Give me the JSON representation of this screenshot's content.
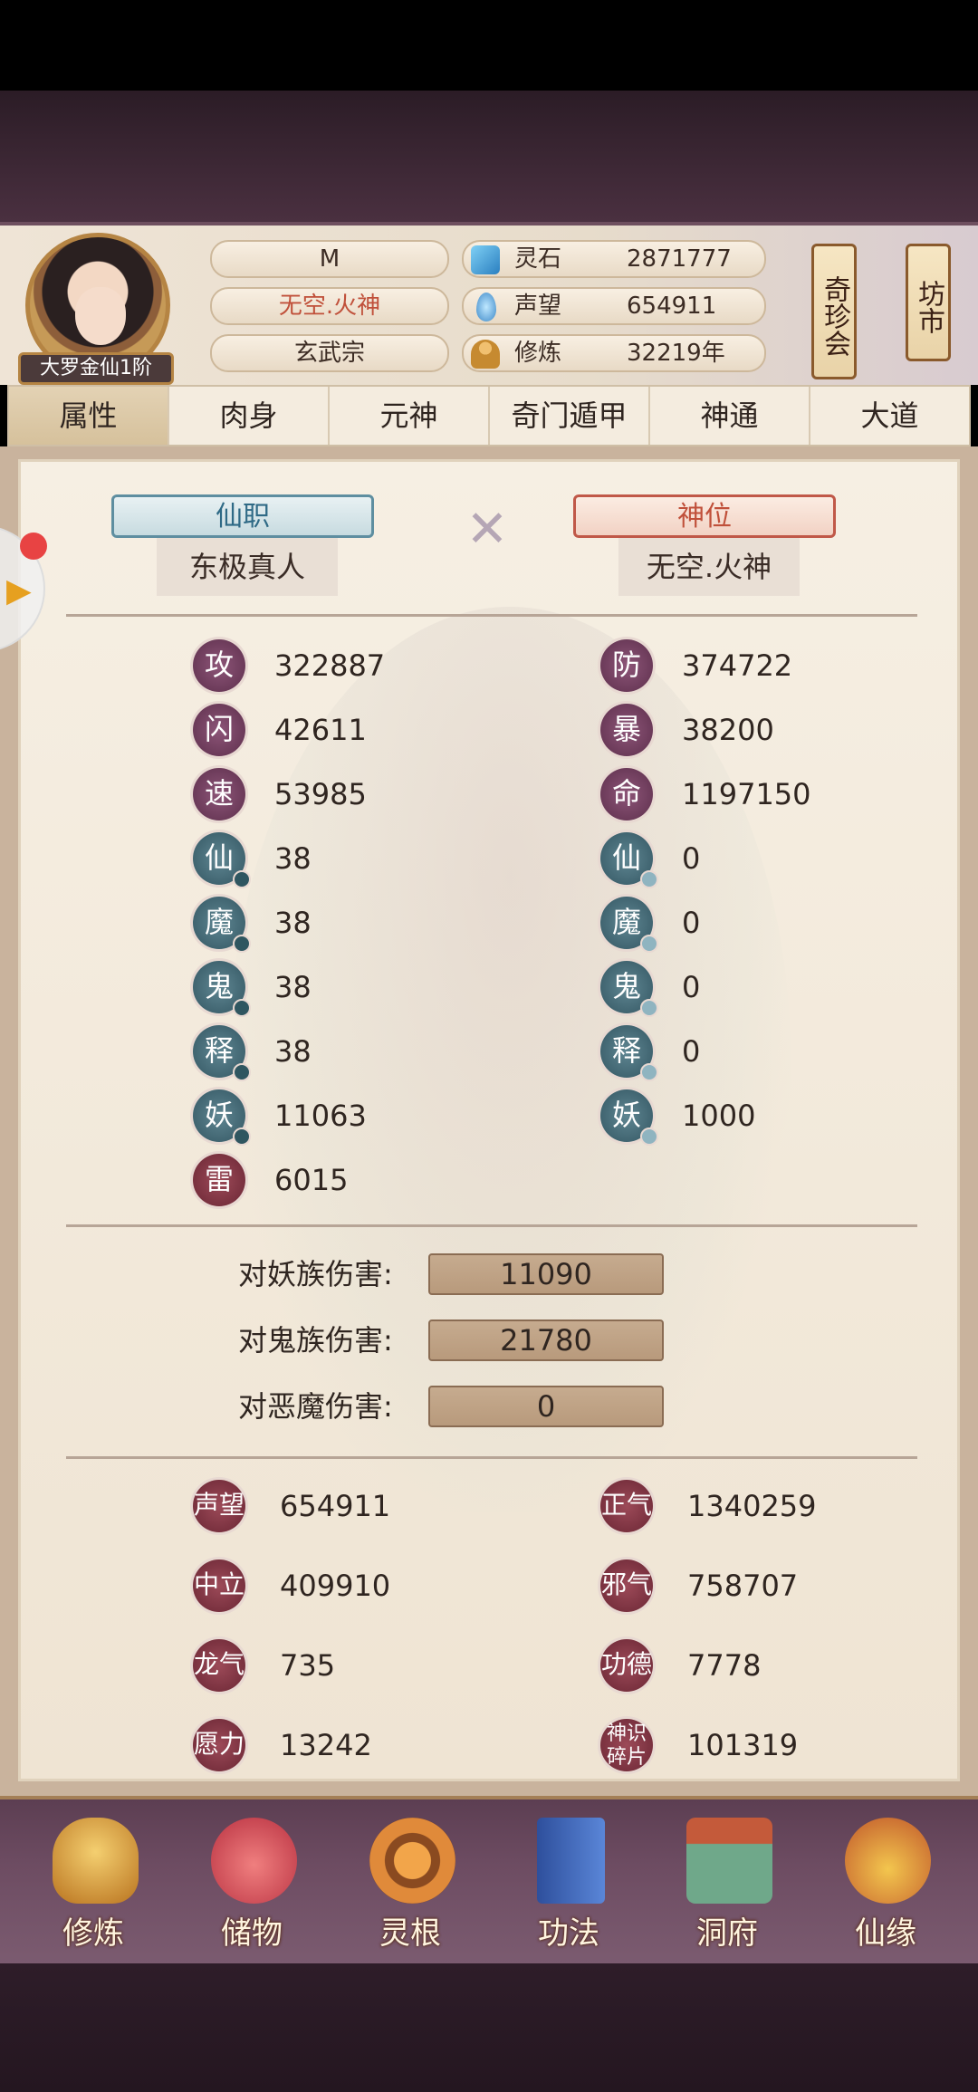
{
  "header": {
    "rank_badge": "大罗金仙1阶",
    "player_name": "M",
    "title": "无空.火神",
    "sect": "玄武宗",
    "resources": [
      {
        "label": "灵石",
        "value": "2871777",
        "icon": "spirit-stone-icon"
      },
      {
        "label": "声望",
        "value": "654911",
        "icon": "reputation-icon"
      },
      {
        "label": "修炼",
        "value": "32219年",
        "icon": "meditation-icon"
      }
    ],
    "scrolls": [
      "奇珍会",
      "坊市"
    ]
  },
  "tabs": [
    "属性",
    "肉身",
    "元神",
    "奇门遁甲",
    "神通",
    "大道"
  ],
  "active_tab": 0,
  "positions": {
    "immortal_office_label": "仙职",
    "immortal_office_value": "东极真人",
    "god_position_label": "神位",
    "god_position_value": "无空.火神"
  },
  "stats_left": [
    {
      "glyph": "攻",
      "value": "322887"
    },
    {
      "glyph": "闪",
      "value": "42611"
    },
    {
      "glyph": "速",
      "value": "53985"
    },
    {
      "glyph": "仙",
      "value": "38"
    },
    {
      "glyph": "魔",
      "value": "38"
    },
    {
      "glyph": "鬼",
      "value": "38"
    },
    {
      "glyph": "释",
      "value": "38"
    },
    {
      "glyph": "妖",
      "value": "11063"
    },
    {
      "glyph": "雷",
      "value": "6015"
    }
  ],
  "stats_right": [
    {
      "glyph": "防",
      "value": "374722"
    },
    {
      "glyph": "暴",
      "value": "38200"
    },
    {
      "glyph": "命",
      "value": "1197150"
    },
    {
      "glyph": "仙",
      "value": "0"
    },
    {
      "glyph": "魔",
      "value": "0"
    },
    {
      "glyph": "鬼",
      "value": "0"
    },
    {
      "glyph": "释",
      "value": "0"
    },
    {
      "glyph": "妖",
      "value": "1000"
    }
  ],
  "damage": [
    {
      "label": "对妖族伤害:",
      "value": "11090"
    },
    {
      "label": "对鬼族伤害:",
      "value": "21780"
    },
    {
      "label": "对恶魔伤害:",
      "value": "0"
    }
  ],
  "extra_left": [
    {
      "label": "声望",
      "value": "654911"
    },
    {
      "label": "中立",
      "value": "409910"
    },
    {
      "label": "龙气",
      "value": "735"
    },
    {
      "label": "愿力",
      "value": "13242"
    }
  ],
  "extra_right": [
    {
      "label": "正气",
      "value": "1340259"
    },
    {
      "label": "邪气",
      "value": "758707"
    },
    {
      "label": "功德",
      "value": "7778"
    },
    {
      "label": "神识碎片",
      "value": "101319"
    }
  ],
  "bottom_nav": [
    {
      "label": "修炼",
      "icon": "cultivate-icon"
    },
    {
      "label": "储物",
      "icon": "storage-bag-icon"
    },
    {
      "label": "灵根",
      "icon": "spirit-root-icon"
    },
    {
      "label": "功法",
      "icon": "technique-book-icon"
    },
    {
      "label": "洞府",
      "icon": "cave-dwelling-icon"
    },
    {
      "label": "仙缘",
      "icon": "fate-gourd-icon"
    }
  ]
}
